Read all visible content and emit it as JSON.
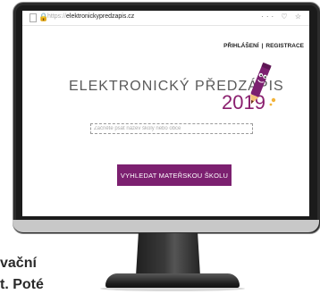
{
  "browser": {
    "url_protocol": "https://",
    "url_host": "elektronickypredzapis.cz",
    "controls": "··· ♡ ☆"
  },
  "site": {
    "nav_login": "PŘIHLÁŠENÍ",
    "nav_separator": "|",
    "nav_register": "REGISTRACE",
    "logo_text": "ELEKTRONICKÝ PŘEDZÁPIS",
    "logo_year": "2019",
    "search_placeholder": "Začněte psát název školy nebo obce",
    "search_button": "VYHLEDAT MATEŘSKOU ŠKOLU"
  },
  "page_text": {
    "line1": "vační",
    "line2": "t. Poté"
  },
  "colors": {
    "brand_purple": "#7c2070",
    "year_color": "#8a1f6e",
    "lock_green": "#3a9a3a"
  }
}
